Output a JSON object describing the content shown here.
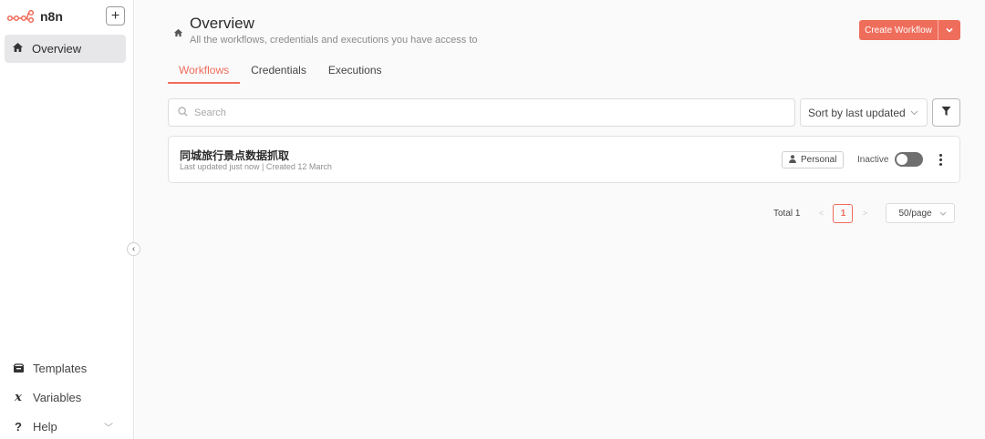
{
  "brand": {
    "name": "n8n",
    "accent": "#ef6d5b"
  },
  "sidebar": {
    "add_label": "+",
    "items": [
      {
        "label": "Overview",
        "icon": "home-icon"
      }
    ],
    "collapse_label": "‹",
    "bottom_items": [
      {
        "label": "Templates",
        "icon": "templates-icon"
      },
      {
        "label": "Variables",
        "icon": "variables-icon"
      },
      {
        "label": "Help",
        "icon": "help-icon"
      }
    ]
  },
  "header": {
    "title": "Overview",
    "subtitle": "All the workflows, credentials and executions you have access to",
    "create_label": "Create Workflow"
  },
  "tabs": [
    {
      "label": "Workflows",
      "active": true
    },
    {
      "label": "Credentials",
      "active": false
    },
    {
      "label": "Executions",
      "active": false
    }
  ],
  "search": {
    "placeholder": "Search",
    "value": ""
  },
  "sort": {
    "value": "Sort by last updated"
  },
  "workflows": [
    {
      "name": "同城旅行景点数据抓取",
      "meta": "Last updated just now | Created 12 March",
      "owner": "Personal",
      "status": "Inactive",
      "active": false
    }
  ],
  "pagination": {
    "total": "Total 1",
    "current": "1",
    "page_size": "50/page"
  }
}
